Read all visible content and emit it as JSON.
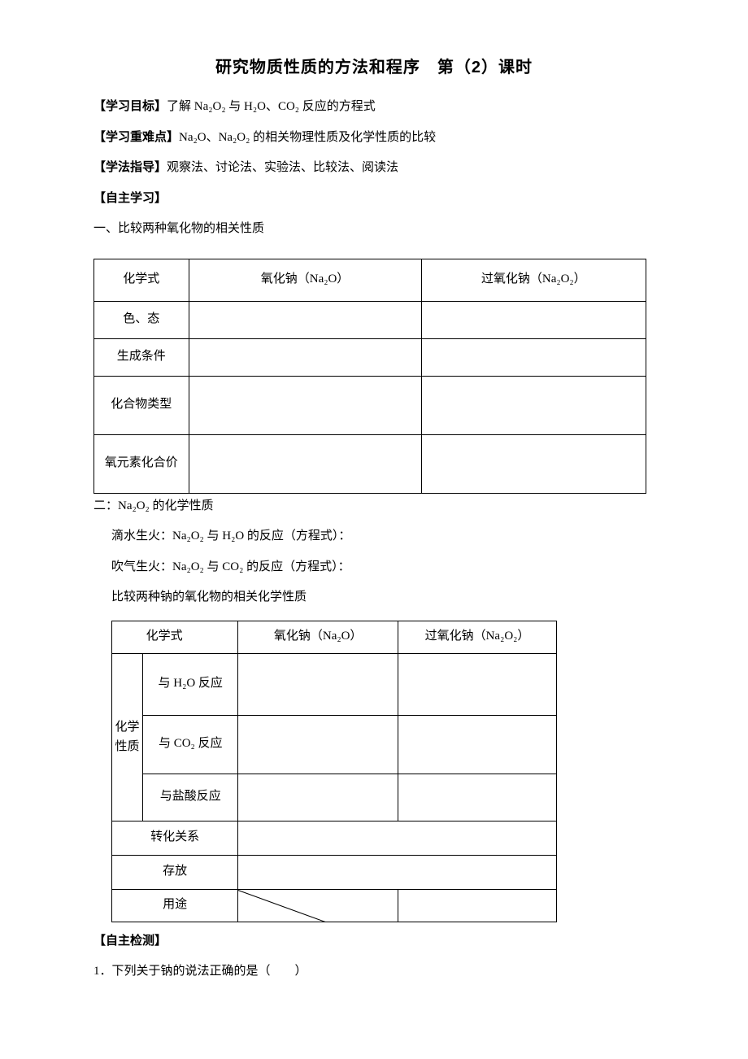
{
  "title": "研究物质性质的方法和程序　第（2）课时",
  "s1": {
    "label": "【学习目标】",
    "text": "了解 Na₂O₂ 与 H₂O、CO₂ 反应的方程式"
  },
  "s2": {
    "label": "【学习重难点】",
    "text": "Na₂O、Na₂O₂ 的相关物理性质及化学性质的比较"
  },
  "s3": {
    "label": "【学法指导】",
    "text": "观察法、讨论法、实验法、比较法、阅读法"
  },
  "s4": {
    "label": "【自主学习】"
  },
  "h1": "一、比较两种氧化物的相关性质",
  "t1": {
    "h_formula": "化学式",
    "h_na2o": "氧化钠（Na₂O）",
    "h_na2o2": "过氧化钠（Na₂O₂）",
    "r1": "色、态",
    "r2": "生成条件",
    "r3": "化合物类型",
    "r4": "氧元素化合价"
  },
  "h2": "二：Na₂O₂ 的化学性质",
  "line1": "滴水生火：Na₂O₂ 与 H₂O 的反应（方程式）：",
  "line2": "吹气生火：Na₂O₂ 与 CO₂ 的反应（方程式）：",
  "line3": "比较两种钠的氧化物的相关化学性质",
  "t2": {
    "h_formula": "化学式",
    "h_na2o": "氧化钠（Na₂O）",
    "h_na2o2": "过氧化钠（Na₂O₂）",
    "v_chem": "化学性质",
    "r_h2o": "与 H₂O 反应",
    "r_co2": "与 CO₂ 反应",
    "r_hcl": "与盐酸反应",
    "r_trans": "转化关系",
    "r_store": "存放",
    "r_use": "用途"
  },
  "s5": {
    "label": "【自主检测】"
  },
  "q1": "1．下列关于钠的说法正确的是（　　）"
}
